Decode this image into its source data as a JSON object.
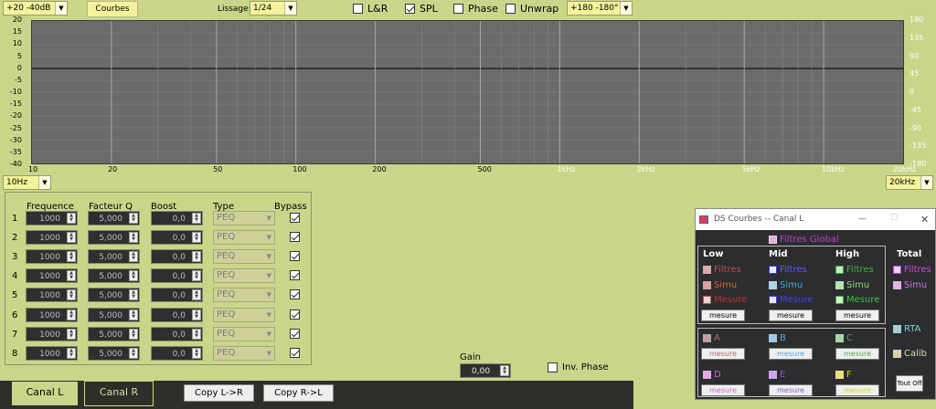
{
  "toolbar": {
    "range": "+20 -40dB",
    "courbes_label": "Courbes",
    "lissage_label": "Lissage:",
    "lissage_value": "1/24",
    "phase_range": "+180 -180°",
    "checkboxes": [
      {
        "label": "L&R",
        "checked": false
      },
      {
        "label": "SPL",
        "checked": true
      },
      {
        "label": "Phase",
        "checked": false
      },
      {
        "label": "Unwrap",
        "checked": false
      }
    ]
  },
  "graph": {
    "y_left_ticks": [
      "20",
      "15",
      "10",
      "5",
      "0",
      "-5",
      "-10",
      "-15",
      "-20",
      "-25",
      "-30",
      "-35",
      "-40"
    ],
    "y_right_ticks": [
      "180",
      "135",
      "90",
      "45",
      "0",
      "-45",
      "-90",
      "-135",
      "-180"
    ],
    "x_ticks": [
      {
        "label": "10",
        "white": false
      },
      {
        "label": "20",
        "white": false
      },
      {
        "label": "50",
        "white": false
      },
      {
        "label": "100",
        "white": false
      },
      {
        "label": "200",
        "white": false
      },
      {
        "label": "500",
        "white": false
      },
      {
        "label": "1kHz",
        "white": true
      },
      {
        "label": "2kHz",
        "white": true
      },
      {
        "label": "5kHz",
        "white": true
      },
      {
        "label": "10kHz",
        "white": true
      },
      {
        "label": "20kHz",
        "white": true
      }
    ],
    "x_min": "10Hz",
    "x_max": "20kHz"
  },
  "peq": {
    "headers": [
      "Frequence",
      "Facteur Q",
      "Boost",
      "Type",
      "Bypass"
    ],
    "rows": [
      {
        "n": "1",
        "freq": "1000",
        "q": "5,000",
        "boost": "0,0",
        "type": "PEQ",
        "bypass": true
      },
      {
        "n": "2",
        "freq": "1000",
        "q": "5,000",
        "boost": "0,0",
        "type": "PEQ",
        "bypass": true
      },
      {
        "n": "3",
        "freq": "1000",
        "q": "5,000",
        "boost": "0,0",
        "type": "PEQ",
        "bypass": true
      },
      {
        "n": "4",
        "freq": "1000",
        "q": "5,000",
        "boost": "0,0",
        "type": "PEQ",
        "bypass": true
      },
      {
        "n": "5",
        "freq": "1000",
        "q": "5,000",
        "boost": "0,0",
        "type": "PEQ",
        "bypass": true
      },
      {
        "n": "6",
        "freq": "1000",
        "q": "5,000",
        "boost": "0,0",
        "type": "PEQ",
        "bypass": true
      },
      {
        "n": "7",
        "freq": "1000",
        "q": "5,000",
        "boost": "0,0",
        "type": "PEQ",
        "bypass": true
      },
      {
        "n": "8",
        "freq": "1000",
        "q": "5,000",
        "boost": "0,0",
        "type": "PEQ",
        "bypass": true
      }
    ]
  },
  "gain": {
    "label": "Gain",
    "value": "0,00"
  },
  "inv_phase": {
    "label": "Inv. Phase",
    "checked": false
  },
  "tabs": [
    "Canal L",
    "Canal R"
  ],
  "copy_buttons": [
    "Copy L->R",
    "Copy R->L"
  ],
  "ds": {
    "title": "DS Courbes -- Canal L",
    "filtres_global": "Filtres Global",
    "col_low": "Low",
    "col_mid": "Mid",
    "col_high": "High",
    "col_total": "Total",
    "filtres": "Filtres",
    "simu": "Simu",
    "mesure": "Mesure",
    "mesure_btn": "mesure",
    "rta": "RTA",
    "calib": "Calib",
    "tout_off": "Tout Off",
    "slots": [
      "A",
      "B",
      "C",
      "D",
      "E",
      "F"
    ],
    "colors": {
      "low": "#c0504d",
      "mid": "#3a3adf",
      "high": "#3da33d",
      "total": "#c040d0",
      "filtres_global": "#c040d0",
      "A": "#b06a6a",
      "B": "#5aa0d8",
      "C": "#4aa84a",
      "D": "#d060d0",
      "E": "#9050c0",
      "F": "#e0d000"
    }
  }
}
